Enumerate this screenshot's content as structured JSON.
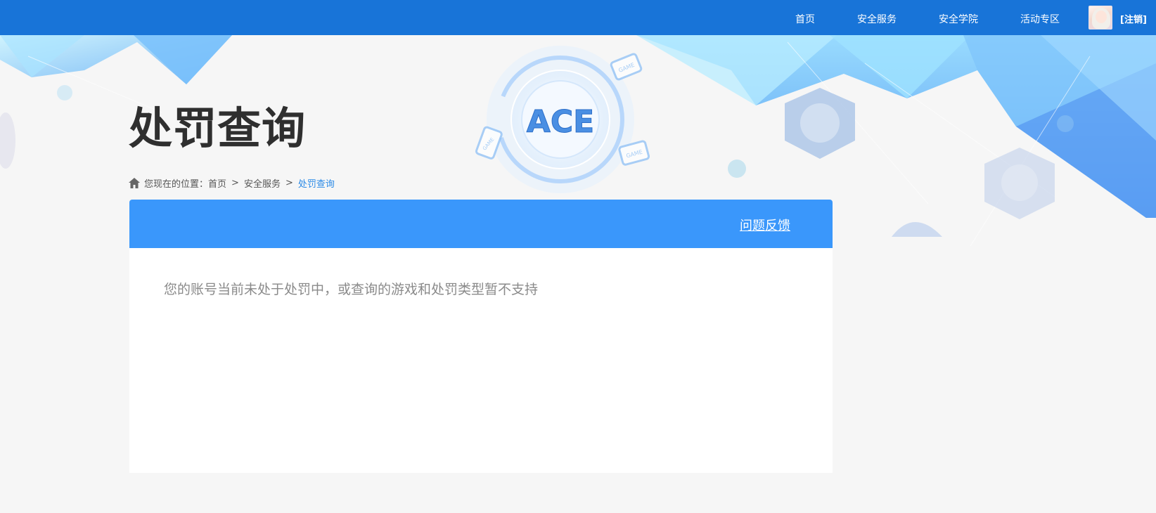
{
  "topbar": {
    "nav": [
      {
        "id": "home",
        "label": "首页"
      },
      {
        "id": "security-service",
        "label": "安全服务"
      },
      {
        "id": "security-academy",
        "label": "安全学院"
      },
      {
        "id": "events",
        "label": "活动专区"
      }
    ],
    "logout_label": "[注销]"
  },
  "banner": {
    "logo_text": "ACE",
    "game_badge": "GAME"
  },
  "page": {
    "title": "处罚查询"
  },
  "breadcrumb": {
    "prefix": "您现在的位置：",
    "items": [
      "首页",
      "安全服务",
      "处罚查询"
    ],
    "separator": ">"
  },
  "card": {
    "feedback_label": "问题反馈",
    "empty_message": "您的账号当前未处于处罚中，或查询的游戏和处罚类型暂不支持"
  },
  "colors": {
    "topbar": "#1874d8",
    "card_header": "#3a97fb",
    "breadcrumb_current": "#2b8ae6",
    "title": "#2f2f2f",
    "message": "#8a8a8a"
  },
  "icons": [
    "home-icon",
    "ace-logo",
    "game-device-icon"
  ]
}
